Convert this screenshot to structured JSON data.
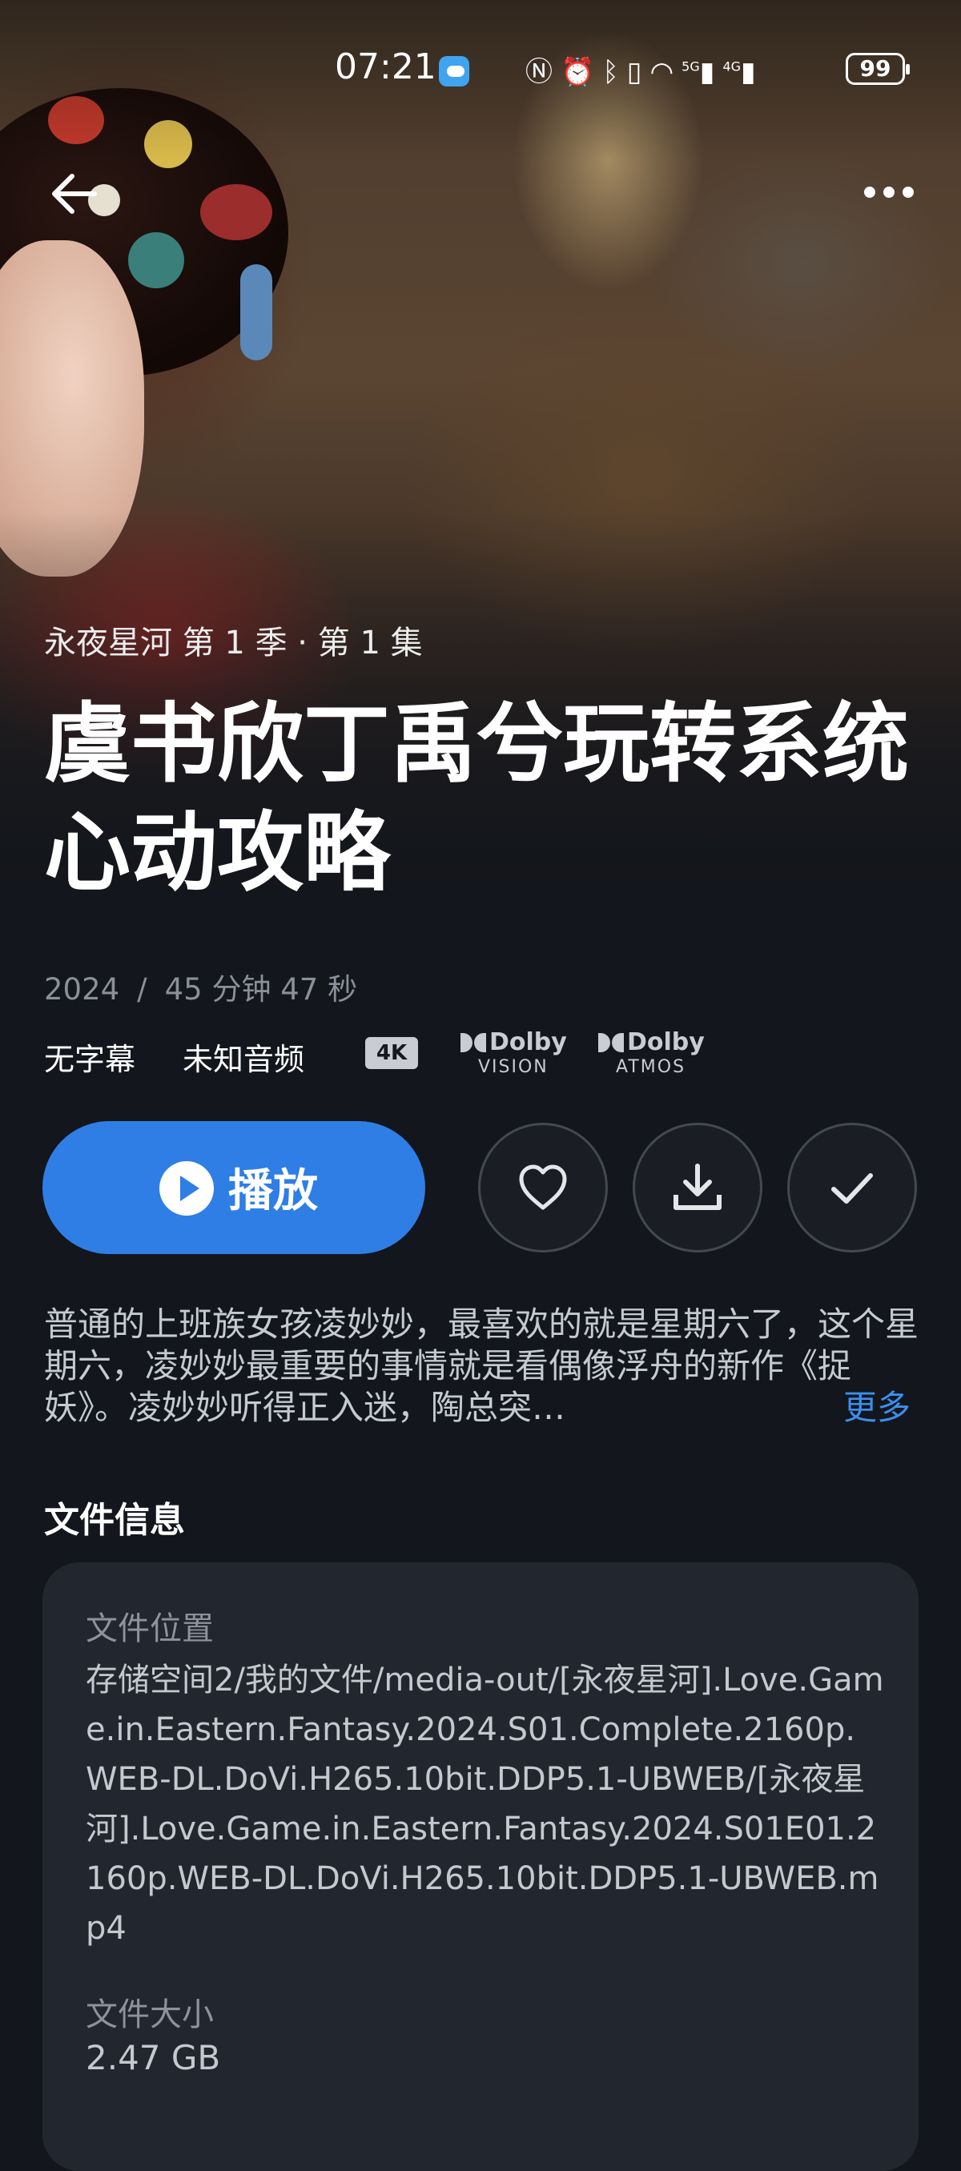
{
  "status_bar": {
    "time": "07:21",
    "signal_1": "5G",
    "signal_2": "4G",
    "battery": "99"
  },
  "nav": {
    "back_icon": "arrow-left-icon",
    "more_icon": "more-horizontal-icon"
  },
  "episode": {
    "label": "永夜星河 第 1 季 · 第 1 集",
    "title": "虞书欣丁禹兮玩转系统心动攻略",
    "year": "2024",
    "separator": "/",
    "duration": "45 分钟 47 秒"
  },
  "tech": {
    "subtitle": "无字幕",
    "audio": "未知音频",
    "resolution": "4K",
    "dolby_vision_word": "Dolby",
    "dolby_vision_sub": "VISION",
    "dolby_atmos_word": "Dolby",
    "dolby_atmos_sub": "ATMOS"
  },
  "actions": {
    "play_label": "播放",
    "favorite_icon": "heart-icon",
    "download_icon": "download-icon",
    "watched_icon": "checkmark-icon"
  },
  "synopsis": {
    "text": "普通的上班族女孩凌妙妙，最喜欢的就是星期六了，这个星期六，凌妙妙最重要的事情就是看偶像浮舟的新作《捉妖》。凌妙妙听得正入迷，陶总突…",
    "more_label": "更多"
  },
  "file_info": {
    "section_title": "文件信息",
    "location_label": "文件位置",
    "location_value": "存储空间2/我的文件/media-out/[永夜星河].Love.Game.in.Eastern.Fantasy.2024.S01.Complete.2160p.WEB-DL.DoVi.H265.10bit.DDP5.1-UBWEB/[永夜星河].Love.Game.in.Eastern.Fantasy.2024.S01E01.2160p.WEB-DL.DoVi.H265.10bit.DDP5.1-UBWEB.mp4",
    "size_label": "文件大小",
    "size_value": "2.47 GB"
  },
  "colors": {
    "background": "#13161c",
    "accent": "#2f7ee6",
    "link": "#3b8fee",
    "card": "#22262e"
  }
}
